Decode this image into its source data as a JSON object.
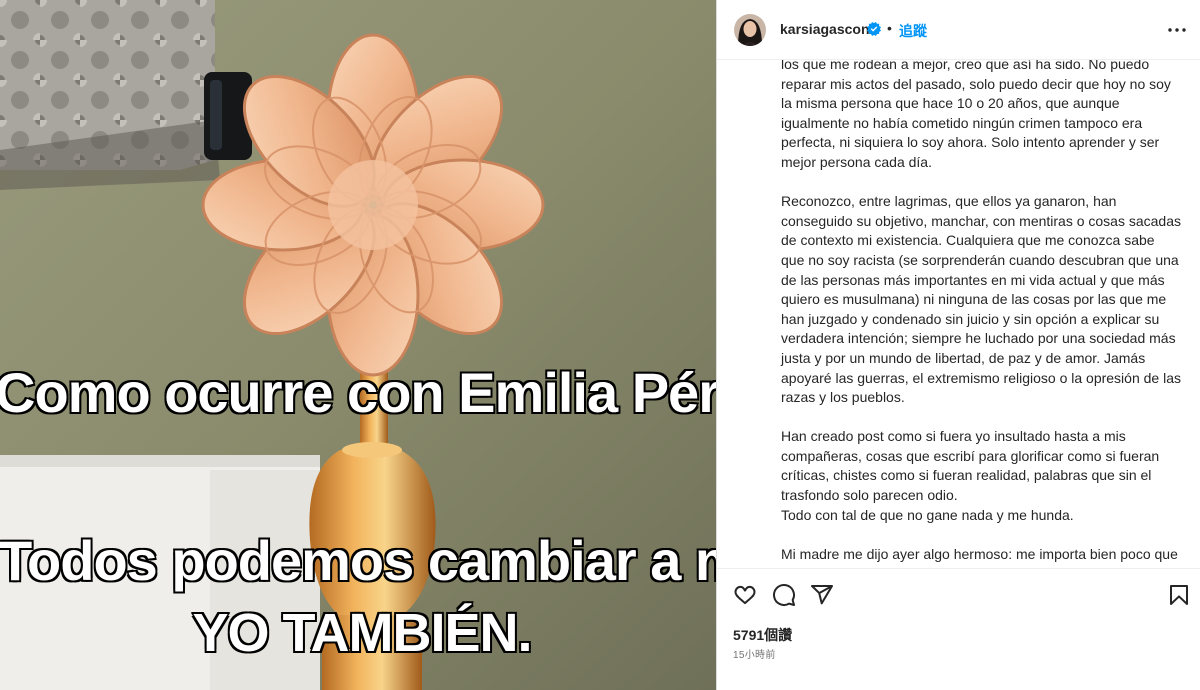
{
  "media": {
    "caption_line1": "Como ocurre con Emilia Pérez:",
    "caption_line2": "Todos podemos cambiar a mejor.",
    "caption_line3": "YO TAMBIÉN."
  },
  "header": {
    "username": "karsiagascon",
    "verified_icon": "verified-badge-icon",
    "separator": "•",
    "follow_label": "追蹤",
    "more_icon": "more-options-icon"
  },
  "post": {
    "paragraphs": [
      "los que me rodean a mejor, creo que así ha sido. No puedo reparar mis actos del pasado, solo puedo decir que hoy no soy la misma persona que hace 10 o 20 años, que aunque igualmente no había cometido ningún crimen tampoco era perfecta, ni siquiera lo soy ahora. Solo intento aprender y ser mejor persona cada día.",
      "Reconozco, entre lagrimas, que ellos ya ganaron, han conseguido su objetivo, manchar, con mentiras o cosas sacadas de contexto mi existencia. Cualquiera que me conozca sabe que no soy racista (se sorprenderán cuando descubran que una de las personas más importantes en mi vida actual y que más quiero es musulmana) ni ninguna de las cosas por las que me han juzgado y condenado sin juicio y sin opción a explicar su verdadera intención; siempre he luchado por una sociedad más justa y por un mundo de libertad, de paz y de amor. Jamás apoyaré las guerras, el extremismo religioso o la opresión de las razas y los pueblos.",
      "Han creado post como si fuera yo insultado hasta a mis compañeras, cosas que escribí para glorificar como si fueran críticas, chistes como si fueran realidad, palabras que sin el trasfondo solo parecen odio.",
      "Todo con tal de que no gane nada y me hunda.",
      "Mi madre me dijo ayer algo hermoso: me importa bien poco que ganes nada, solo quiero que estés bien y no te hagan daño."
    ]
  },
  "actions": {
    "like_icon": "heart-icon",
    "comment_icon": "comment-icon",
    "share_icon": "send-icon",
    "save_icon": "bookmark-icon",
    "likes": "5791個讚",
    "time": "15小時前"
  },
  "colors": {
    "accent": "#0095f6",
    "text": "#262626",
    "muted": "#737373",
    "verified": "#0095f6"
  }
}
